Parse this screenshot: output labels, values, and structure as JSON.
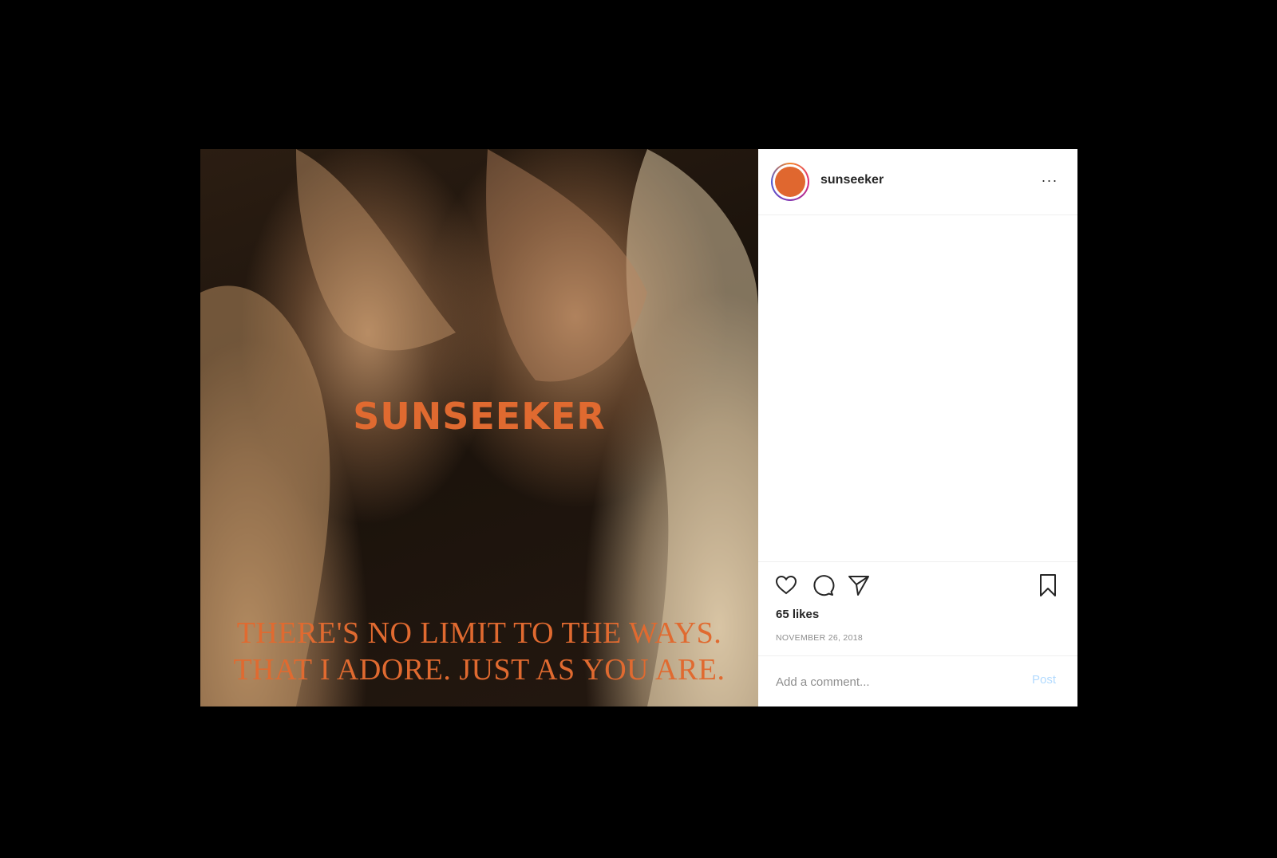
{
  "post": {
    "username": "sunseeker",
    "more_label": "···",
    "likes": "65 likes",
    "date": "NOVEMBER 26, 2018",
    "comment_placeholder": "Add a comment...",
    "post_button": "Post"
  },
  "image": {
    "brand_title": "SUNSEEKER",
    "caption_line1": "THERE'S NO LIMIT TO THE WAYS.",
    "caption_line2": "THAT I ADORE. JUST AS YOU ARE."
  },
  "icons": {
    "like": "heart-icon",
    "comment": "comment-bubble-icon",
    "share": "paper-plane-icon",
    "save": "bookmark-icon"
  },
  "colors": {
    "accent": "#e06a30",
    "avatar_fill": "#e0672f",
    "post_button": "#b3dbff"
  }
}
